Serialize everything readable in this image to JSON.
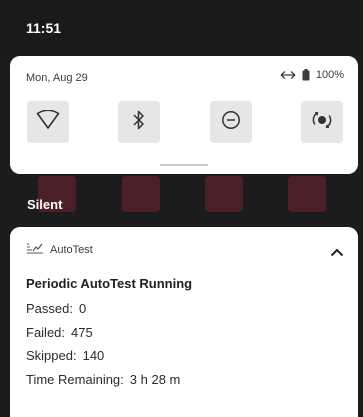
{
  "status_bar": {
    "time": "11:51"
  },
  "quick_settings": {
    "date": "Mon, Aug 29",
    "battery": "100%",
    "tiles": [
      {
        "icon": "wifi-icon"
      },
      {
        "icon": "bluetooth-icon"
      },
      {
        "icon": "do-not-disturb-icon"
      },
      {
        "icon": "auto-rotate-icon"
      }
    ]
  },
  "section": {
    "label": "Silent"
  },
  "notification": {
    "app_name": "AutoTest",
    "title": "Periodic AutoTest Running",
    "passed_label": "Passed:",
    "passed_value": "0",
    "failed_label": "Failed:",
    "failed_value": "475",
    "skipped_label": "Skipped:",
    "skipped_value": "140",
    "remaining_label": "Time Remaining:",
    "remaining_value": "3 h 28 m"
  },
  "colors": {
    "background": "#1c1c1e",
    "panel": "#ffffff",
    "tile": "#e6e6e6",
    "bg_icon_red": "#b4283c"
  }
}
